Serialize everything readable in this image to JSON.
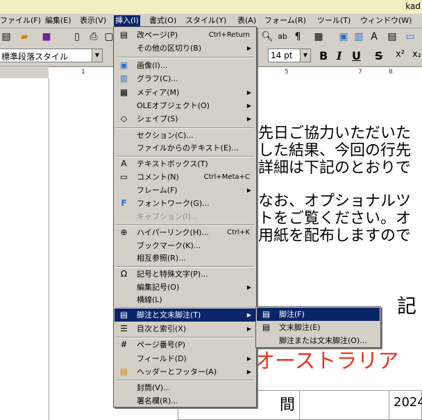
{
  "title_bar": {
    "text": "kad"
  },
  "menubar": {
    "items": [
      {
        "label": "ファイル(F)"
      },
      {
        "label": "編集(E)"
      },
      {
        "label": "表示(V)"
      },
      {
        "label": "挿入(I)"
      },
      {
        "label": "書式(O)"
      },
      {
        "label": "スタイル(Y)"
      },
      {
        "label": "表(A)"
      },
      {
        "label": "フォーム(R)"
      },
      {
        "label": "ツール(T)"
      },
      {
        "label": "ウィンドウ(W)"
      }
    ]
  },
  "toolbar": {
    "paragraph_style": "標準段落スタイル",
    "font_size": "14 pt",
    "bold": "B",
    "italic": "I",
    "underline": "U",
    "strike": "S",
    "superscript": "x²",
    "subscript": "x₂"
  },
  "ruler": {
    "marks": [
      "1",
      "5",
      "7",
      "8"
    ]
  },
  "insert_menu": {
    "items": [
      {
        "label": "改ページ(P)",
        "shortcut": "Ctrl+Return",
        "icon": "page-break-icon"
      },
      {
        "label": "その他の区切り(B)",
        "submenu": true
      },
      {
        "label": "画像(I)...",
        "icon": "image-icon"
      },
      {
        "label": "グラフ(C)...",
        "icon": "chart-icon"
      },
      {
        "label": "メディア(M)",
        "submenu": true,
        "icon": "media-icon"
      },
      {
        "label": "OLEオブジェクト(O)",
        "submenu": true
      },
      {
        "label": "シェイプ(S)",
        "submenu": true,
        "icon": "shapes-icon"
      },
      {
        "label": "セクション(C)..."
      },
      {
        "label": "ファイルからのテキスト(E)..."
      },
      {
        "label": "テキストボックス(T)",
        "icon": "textbox-icon"
      },
      {
        "label": "コメント(N)",
        "shortcut": "Ctrl+Meta+C",
        "icon": "comment-icon"
      },
      {
        "label": "フレーム(F)",
        "submenu": true
      },
      {
        "label": "フォントワーク(G)...",
        "icon": "fontwork-icon"
      },
      {
        "label": "キャプション(I)...",
        "disabled": true
      },
      {
        "label": "ハイパーリンク(H)...",
        "shortcut": "Ctrl+K",
        "icon": "hyperlink-icon"
      },
      {
        "label": "ブックマーク(K)..."
      },
      {
        "label": "相互参照(R)..."
      },
      {
        "label": "記号と特殊文字(P)...",
        "icon": "omega-icon"
      },
      {
        "label": "編集記号(O)",
        "submenu": true
      },
      {
        "label": "横線(L)"
      },
      {
        "label": "脚注と文末脚注(T)",
        "submenu": true,
        "highlighted": true,
        "icon": "footnote-icon"
      },
      {
        "label": "目次と索引(X)",
        "submenu": true,
        "icon": "toc-icon"
      },
      {
        "label": "ページ番号(P)",
        "icon": "page-number-icon"
      },
      {
        "label": "フィールド(D)",
        "submenu": true
      },
      {
        "label": "ヘッダーとフッター(A)",
        "submenu": true,
        "icon": "header-footer-icon"
      },
      {
        "label": "封筒(V)..."
      },
      {
        "label": "署名欄(R)..."
      }
    ]
  },
  "footnote_submenu": {
    "items": [
      {
        "label": "脚注(F)",
        "highlighted": true,
        "icon": "footnote-icon"
      },
      {
        "label": "文末脚注(E)",
        "icon": "endnote-icon"
      },
      {
        "label": "脚注または文末脚注(O)..."
      }
    ]
  },
  "document": {
    "lines": [
      "先日ご協力いただいた",
      "した結果、今回の行先",
      "詳細は下記のとおりで",
      "なお、オプショナルツ",
      "トをご覧ください。オ",
      "用紙を配布しますので"
    ],
    "heading": "記",
    "red_text": "オーストラリア",
    "table_cell_1": "間",
    "table_cell_2": "2024"
  },
  "colors": {
    "highlight": "#0a246a",
    "menu_bg": "#d4d0c8",
    "red_text": "#e8361d"
  }
}
